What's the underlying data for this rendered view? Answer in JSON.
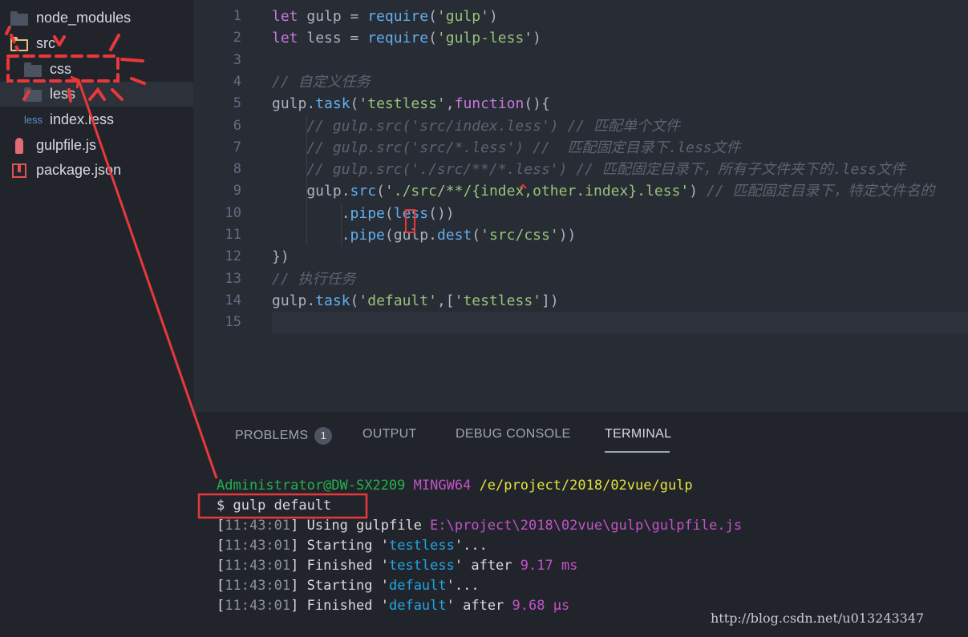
{
  "sidebar": {
    "items": [
      {
        "label": "node_modules",
        "icon": "folder-icon"
      },
      {
        "label": "src",
        "icon": "folder-open-icon"
      },
      {
        "label": "css",
        "icon": "folder-icon"
      },
      {
        "label": "less",
        "icon": "folder-icon"
      },
      {
        "label": "index.less",
        "icon": "less-file-icon",
        "icon_text": "less"
      },
      {
        "label": "gulpfile.js",
        "icon": "gulp-file-icon"
      },
      {
        "label": "package.json",
        "icon": "package-file-icon"
      }
    ]
  },
  "editor": {
    "line_numbers": [
      "1",
      "2",
      "3",
      "4",
      "5",
      "6",
      "7",
      "8",
      "9",
      "10",
      "11",
      "12",
      "13",
      "14",
      "15"
    ],
    "lines": [
      {
        "t": [
          [
            "kw",
            "let "
          ],
          [
            "pl",
            "gulp = "
          ],
          [
            "fn",
            "require"
          ],
          [
            "pl",
            "("
          ],
          [
            "str",
            "'gulp'"
          ],
          [
            "pl",
            ")"
          ]
        ]
      },
      {
        "t": [
          [
            "kw",
            "let "
          ],
          [
            "pl",
            "less = "
          ],
          [
            "fn",
            "require"
          ],
          [
            "pl",
            "("
          ],
          [
            "str",
            "'gulp-less'"
          ],
          [
            "pl",
            ")"
          ]
        ]
      },
      {
        "t": []
      },
      {
        "t": [
          [
            "cm",
            "// 自定义任务"
          ]
        ]
      },
      {
        "t": [
          [
            "pl",
            "gulp."
          ],
          [
            "fn",
            "task"
          ],
          [
            "pl",
            "("
          ],
          [
            "str",
            "'testless'"
          ],
          [
            "pl",
            ","
          ],
          [
            "kw",
            "function"
          ],
          [
            "pl",
            "(){"
          ]
        ]
      },
      {
        "t": [
          [
            "cm",
            "    // gulp.src('src/index.less') // 匹配单个文件"
          ]
        ]
      },
      {
        "t": [
          [
            "cm",
            "    // gulp.src('src/*.less') //  匹配固定目录下.less文件"
          ]
        ]
      },
      {
        "t": [
          [
            "cm",
            "    // gulp.src('./src/**/*.less') // 匹配固定目录下，所有子文件夹下的.less文件"
          ]
        ]
      },
      {
        "t": [
          [
            "pl",
            "    gulp."
          ],
          [
            "fn",
            "src"
          ],
          [
            "pl",
            "("
          ],
          [
            "str",
            "'./src/**/{index,other.index}.less'"
          ],
          [
            "pl",
            ") "
          ],
          [
            "cm",
            "// 匹配固定目录下，特定文件名的"
          ]
        ]
      },
      {
        "t": [
          [
            "pl",
            "        ."
          ],
          [
            "fn",
            "pipe"
          ],
          [
            "pl",
            "("
          ],
          [
            "fn",
            "less"
          ],
          [
            "pl",
            "())"
          ]
        ]
      },
      {
        "t": [
          [
            "pl",
            "        ."
          ],
          [
            "fn",
            "pipe"
          ],
          [
            "pl",
            "(gulp."
          ],
          [
            "fn",
            "dest"
          ],
          [
            "pl",
            "("
          ],
          [
            "str",
            "'src/css'"
          ],
          [
            "pl",
            "))"
          ]
        ]
      },
      {
        "t": [
          [
            "pl",
            "})"
          ]
        ]
      },
      {
        "t": [
          [
            "cm",
            "// 执行任务"
          ]
        ]
      },
      {
        "t": [
          [
            "pl",
            "gulp."
          ],
          [
            "fn",
            "task"
          ],
          [
            "pl",
            "("
          ],
          [
            "str",
            "'default'"
          ],
          [
            "pl",
            ",["
          ],
          [
            "str",
            "'testless'"
          ],
          [
            "pl",
            "])"
          ]
        ]
      },
      {
        "t": []
      }
    ]
  },
  "panel": {
    "tabs": [
      {
        "label": "PROBLEMS",
        "badge": "1"
      },
      {
        "label": "OUTPUT"
      },
      {
        "label": "DEBUG CONSOLE"
      },
      {
        "label": "TERMINAL",
        "active": true
      }
    ],
    "terminal": {
      "prompt_user": "Administrator@DW-SX2209",
      "prompt_env": "MINGW64",
      "prompt_path": "/e/project/2018/02vue/gulp",
      "command": "$ gulp default",
      "output": [
        {
          "time": "11:43:01",
          "pre": "Using gulpfile ",
          "hl": "E:\\project\\2018\\02vue\\gulp\\gulpfile.js",
          "hl_color": "mag",
          "post": ""
        },
        {
          "time": "11:43:01",
          "pre": "Starting '",
          "hl": "testless",
          "hl_color": "cyan",
          "post": "'..."
        },
        {
          "time": "11:43:01",
          "pre": "Finished '",
          "hl": "testless",
          "hl_color": "cyan",
          "post": "' after ",
          "val": "9.17 ms"
        },
        {
          "time": "11:43:01",
          "pre": "Starting '",
          "hl": "default",
          "hl_color": "cyan",
          "post": "'..."
        },
        {
          "time": "11:43:01",
          "pre": "Finished '",
          "hl": "default",
          "hl_color": "cyan",
          "post": "' after ",
          "val": "9.68 μs"
        }
      ]
    }
  },
  "watermark": "http://blog.csdn.net/u013243347",
  "colors": {
    "annotation": "#e8383b",
    "accent": "#61afef"
  }
}
